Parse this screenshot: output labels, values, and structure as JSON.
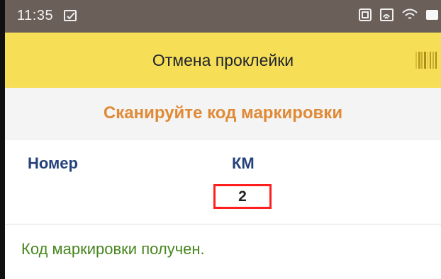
{
  "status_bar": {
    "time": "11:35",
    "icons": [
      "notification-icon",
      "nfc-icon",
      "signal-icon",
      "wifi-icon",
      "battery-icon"
    ]
  },
  "app_bar": {
    "title": "Отмена проклейки",
    "barcode_icon": "barcode-icon"
  },
  "prompt": {
    "text": "Сканируйте код маркировки"
  },
  "fields": {
    "number_label": "Номер",
    "km_label": "КМ",
    "km_value": "2"
  },
  "result": {
    "message": "Код маркировки получен."
  },
  "colors": {
    "status_bar": "#6b5f59",
    "app_bar": "#f6df56",
    "prompt_text": "#e08a36",
    "label_text": "#26427b",
    "success_text": "#47861e",
    "highlight_border": "#ff1f1f"
  }
}
